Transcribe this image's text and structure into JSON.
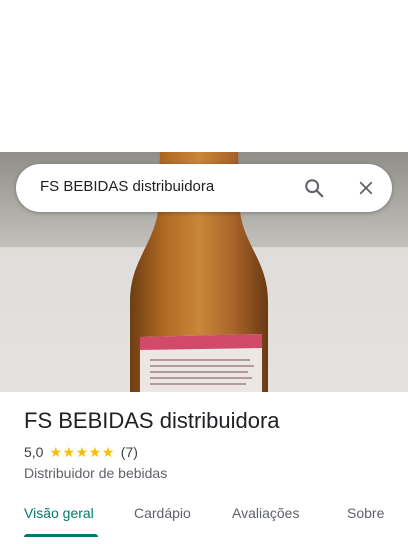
{
  "search": {
    "query": "FS BEBIDAS distribuidora",
    "search_icon": "search-icon",
    "close_icon": "close-icon"
  },
  "place": {
    "name": "FS BEBIDAS distribuidora",
    "rating": "5,0",
    "stars": 5,
    "review_count": "(7)",
    "category": "Distribuidor de bebidas"
  },
  "tabs": [
    {
      "label": "Visão geral",
      "active": true
    },
    {
      "label": "Cardápio",
      "active": false
    },
    {
      "label": "Avaliações",
      "active": false
    },
    {
      "label": "Sobre",
      "active": false
    }
  ],
  "colors": {
    "accent": "#00796b",
    "star": "#fbbc04"
  }
}
